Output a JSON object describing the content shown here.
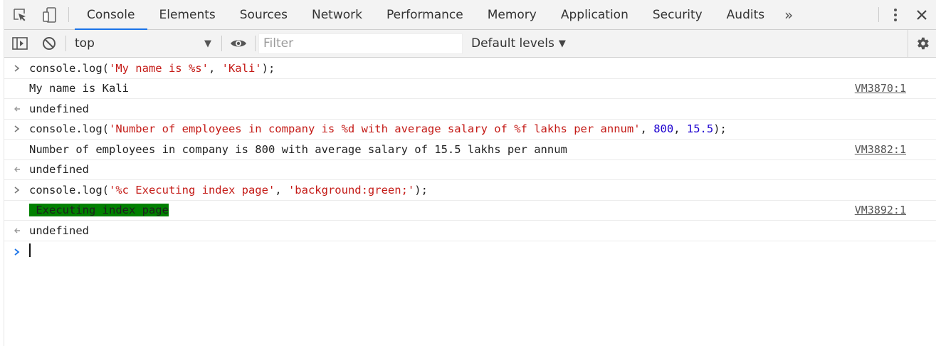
{
  "tabs": [
    "Console",
    "Elements",
    "Sources",
    "Network",
    "Performance",
    "Memory",
    "Application",
    "Security",
    "Audits"
  ],
  "more_tabs_label": "»",
  "toolbar": {
    "context": "top",
    "filter_placeholder": "Filter",
    "levels": "Default levels"
  },
  "console": {
    "entries": [
      {
        "type": "input"
      },
      {
        "type": "log",
        "text": "My name is Kali",
        "source": "VM3870:1"
      },
      {
        "type": "result",
        "text": "undefined"
      },
      {
        "type": "input"
      },
      {
        "type": "log",
        "text": "Number of employees in company is 800 with average salary of 15.5 lakhs per annum",
        "source": "VM3882:1"
      },
      {
        "type": "result",
        "text": "undefined"
      },
      {
        "type": "input"
      },
      {
        "type": "log",
        "text": " Executing index page",
        "source": "VM3892:1",
        "background": "#008000"
      },
      {
        "type": "result",
        "text": "undefined"
      }
    ],
    "cmd1": {
      "a": "console.log(",
      "s1": "'My name is %s'",
      "b": ", ",
      "s2": "'Kali'",
      "c": ");"
    },
    "cmd2": {
      "a": "console.log(",
      "s1": "'Number of employees in company is %d with average salary of %f lakhs per annum'",
      "b": ", ",
      "n1": "800",
      "c": ", ",
      "n2": "15.5",
      "d": ");"
    },
    "cmd3": {
      "a": "console.log(",
      "s1": "'%c Executing index page'",
      "b": ", ",
      "s2": "'background:green;'",
      "c": ");"
    }
  },
  "colors": {
    "accent": "#1a73e8",
    "string": "#c41a16",
    "number": "#1c00cf",
    "muted": "#808080"
  }
}
